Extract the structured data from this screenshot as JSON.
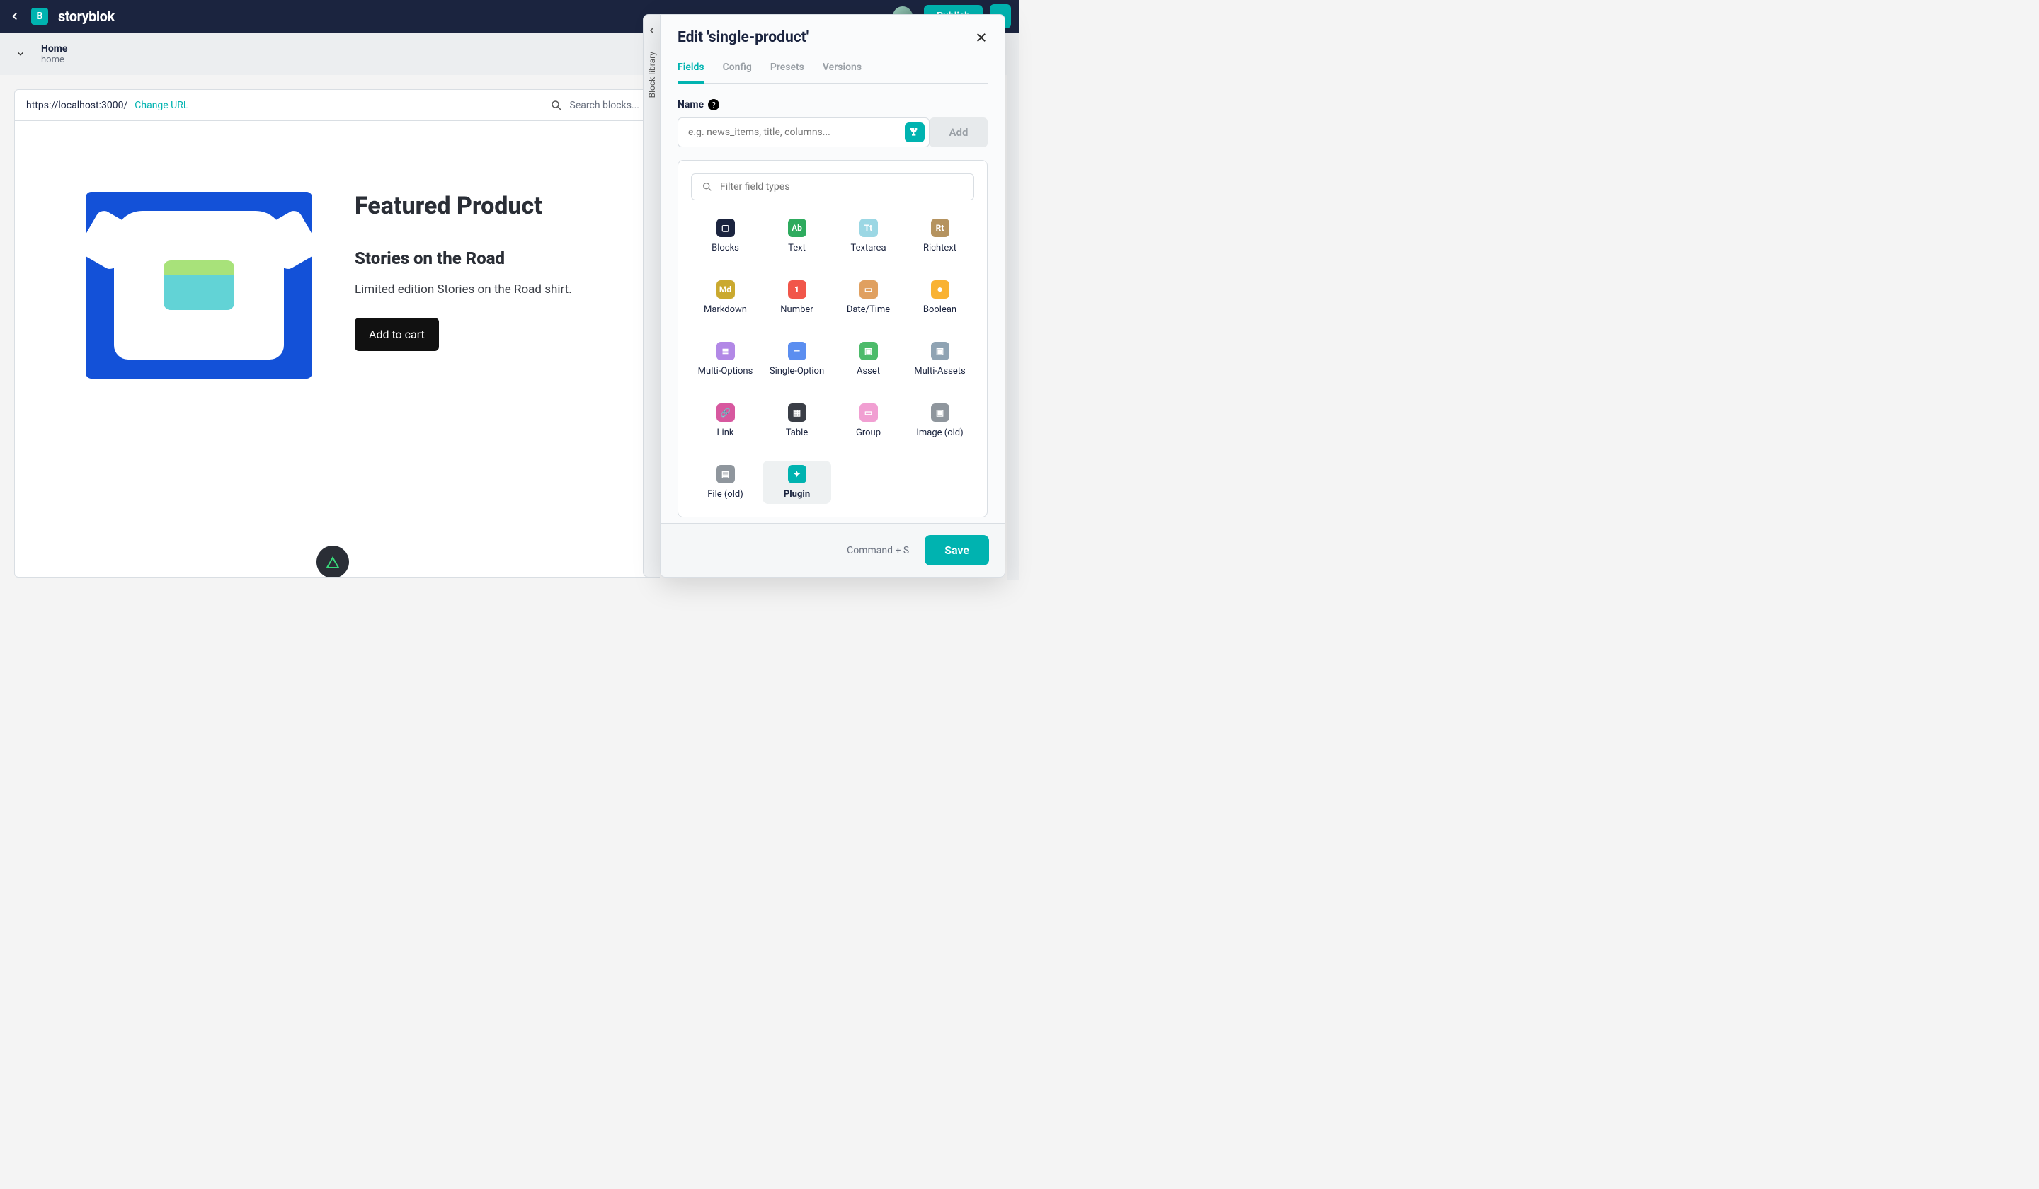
{
  "topbar": {
    "logo_text": "storyblok",
    "publish_label": "Publish"
  },
  "breadcrumb": {
    "title": "Home",
    "slug": "home"
  },
  "preview": {
    "url": "https://localhost:3000/",
    "change_url_label": "Change URL",
    "search_placeholder": "Search blocks...",
    "product_heading": "Featured Product",
    "product_name": "Stories on the Road",
    "product_desc": "Limited edition Stories on the Road shirt.",
    "add_to_cart_label": "Add to cart"
  },
  "library_tab": {
    "label": "Block library"
  },
  "panel": {
    "title": "Edit 'single-product'",
    "tabs": [
      "Fields",
      "Config",
      "Presets",
      "Versions"
    ],
    "active_tab": "Fields",
    "name_label": "Name",
    "name_placeholder": "e.g. news_items, title, columns...",
    "add_label": "Add",
    "filter_placeholder": "Filter field types",
    "types": [
      {
        "label": "Blocks",
        "icon": "i-blocks",
        "glyph": "▢"
      },
      {
        "label": "Text",
        "icon": "i-text",
        "glyph": "Ab"
      },
      {
        "label": "Textarea",
        "icon": "i-textarea",
        "glyph": "Tt"
      },
      {
        "label": "Richtext",
        "icon": "i-richtext",
        "glyph": "Rt"
      },
      {
        "label": "Markdown",
        "icon": "i-md",
        "glyph": "Md"
      },
      {
        "label": "Number",
        "icon": "i-num",
        "glyph": "1"
      },
      {
        "label": "Date/Time",
        "icon": "i-date",
        "glyph": "▭"
      },
      {
        "label": "Boolean",
        "icon": "i-bool",
        "glyph": "⏺"
      },
      {
        "label": "Multi-Options",
        "icon": "i-multiopt",
        "glyph": "≣"
      },
      {
        "label": "Single-Option",
        "icon": "i-singopt",
        "glyph": "—"
      },
      {
        "label": "Asset",
        "icon": "i-asset",
        "glyph": "▣"
      },
      {
        "label": "Multi-Assets",
        "icon": "i-multiasset",
        "glyph": "▣"
      },
      {
        "label": "Link",
        "icon": "i-link",
        "glyph": "🔗"
      },
      {
        "label": "Table",
        "icon": "i-table",
        "glyph": "▦"
      },
      {
        "label": "Group",
        "icon": "i-group",
        "glyph": "▭"
      },
      {
        "label": "Image (old)",
        "icon": "i-imgold",
        "glyph": "▣"
      },
      {
        "label": "File (old)",
        "icon": "i-fileold",
        "glyph": "▤"
      },
      {
        "label": "Plugin",
        "icon": "i-plugin",
        "glyph": "✦",
        "selected": true
      }
    ],
    "shortcut_hint": "Command + S",
    "save_label": "Save"
  }
}
